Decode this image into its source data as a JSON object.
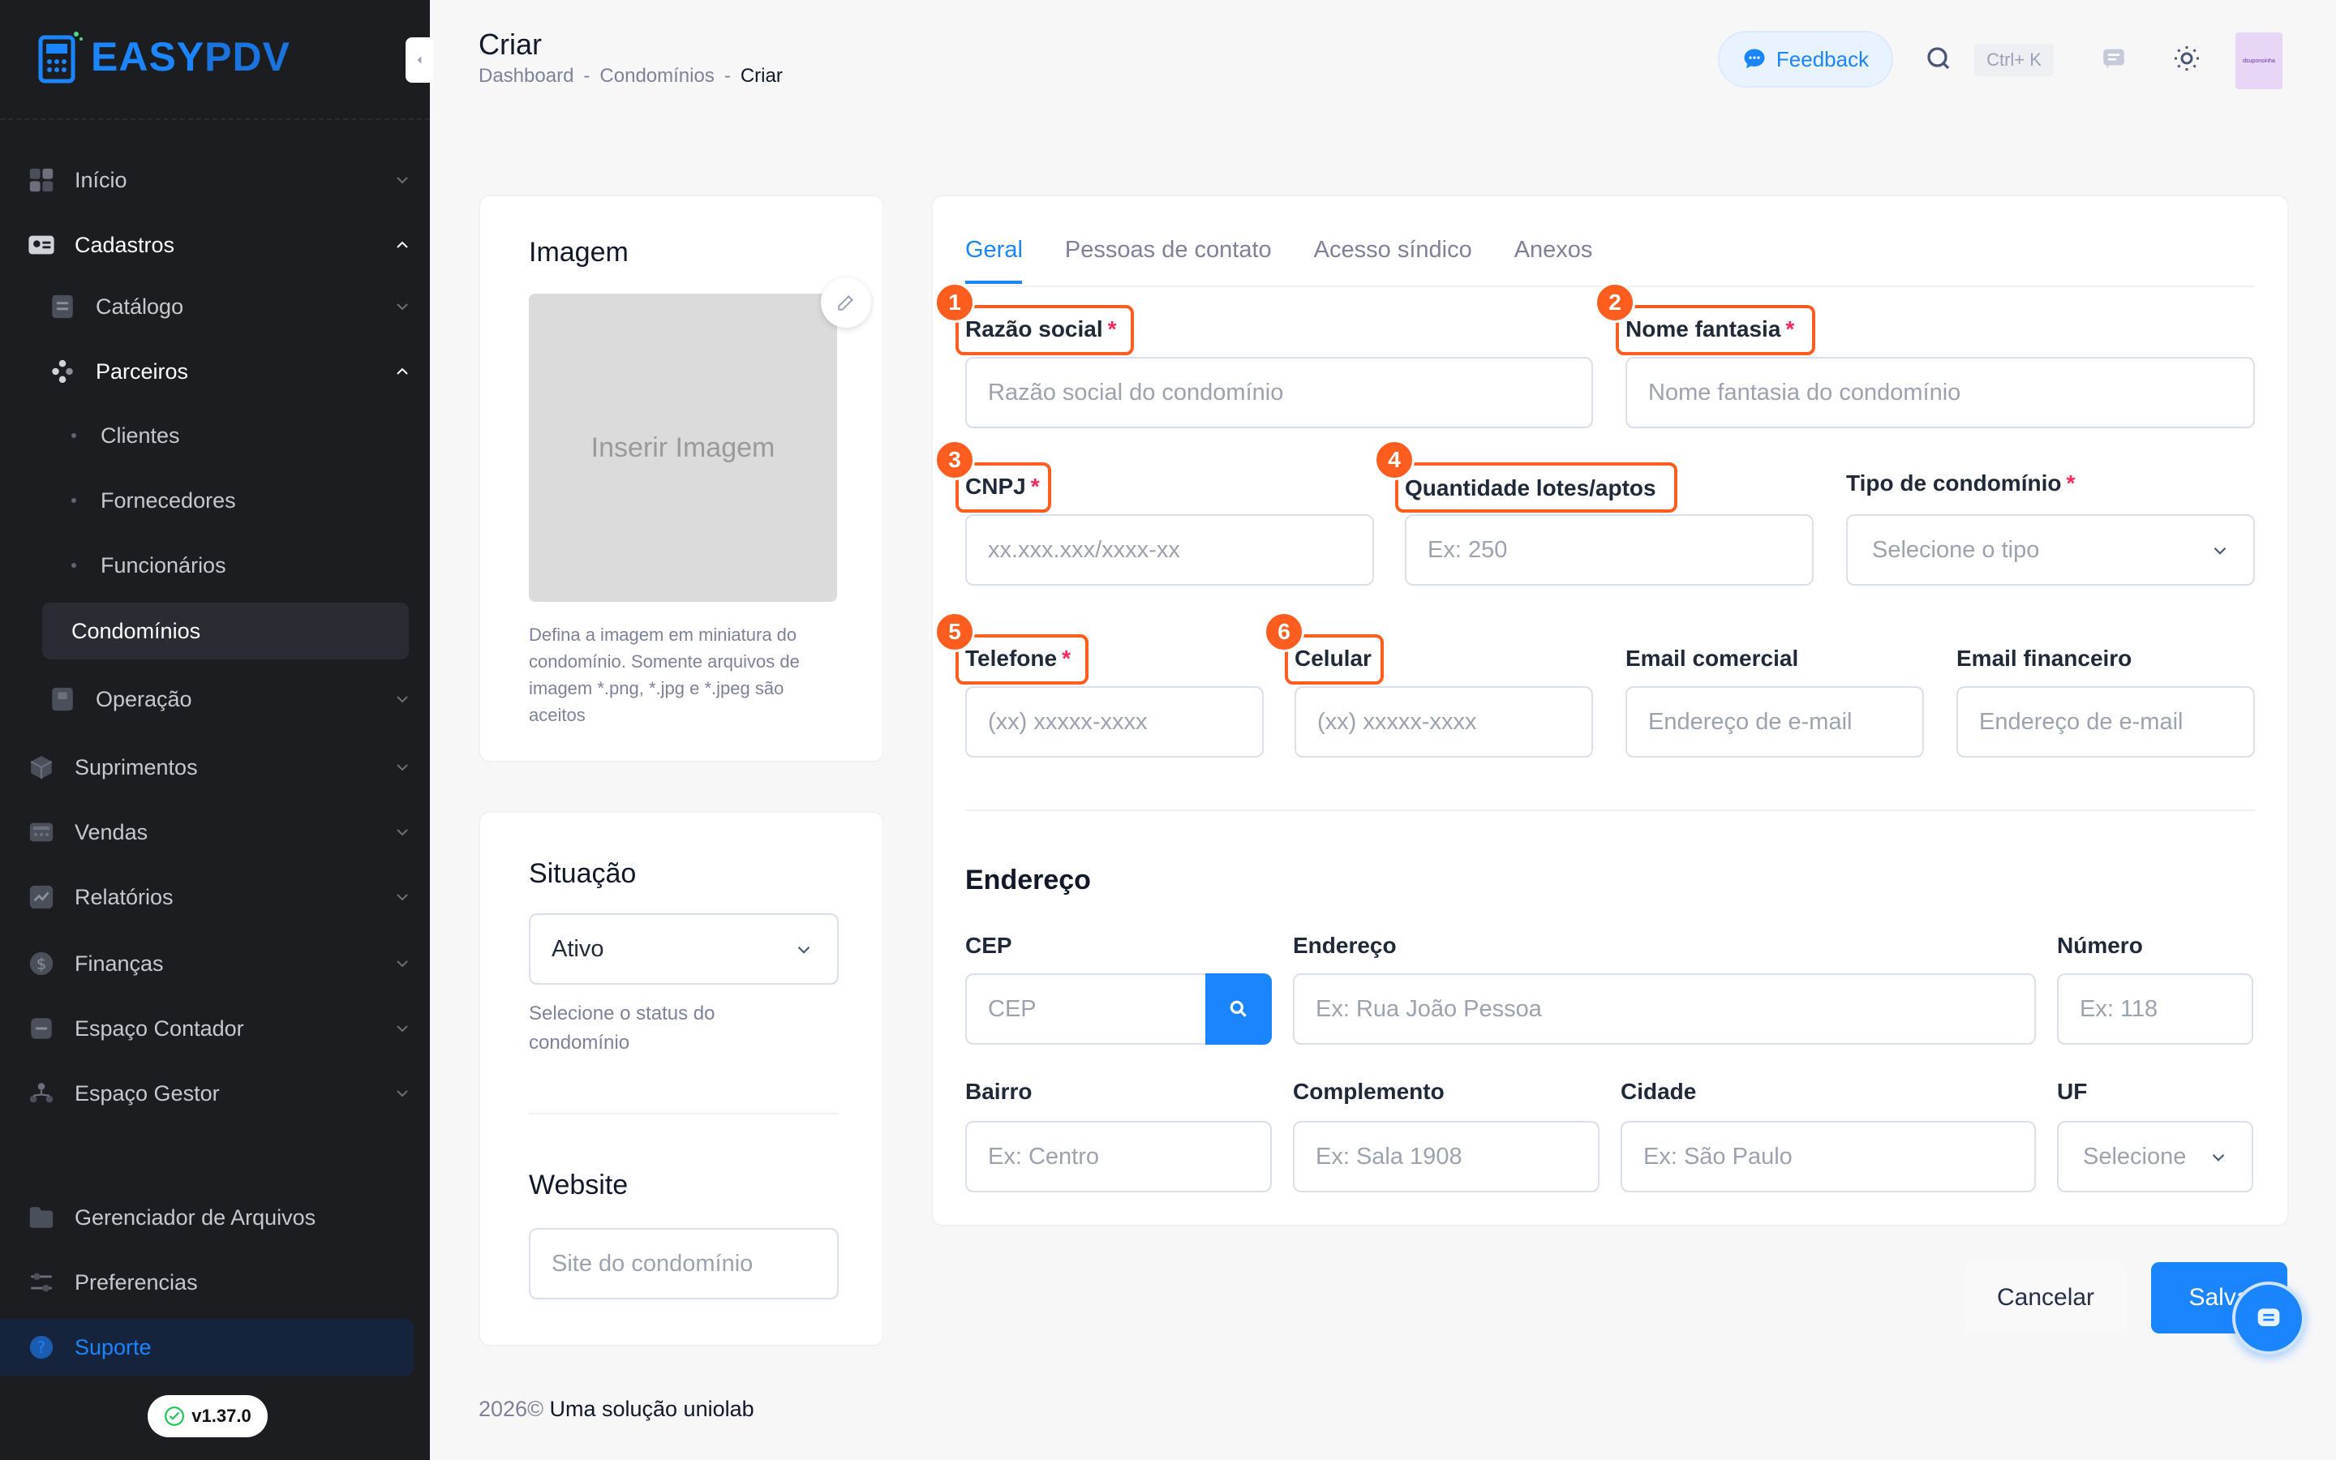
{
  "sidebar": {
    "logo_easy": "EASY",
    "logo_pdv": "PDV",
    "items": [
      {
        "label": "Início"
      },
      {
        "label": "Cadastros"
      },
      {
        "label": "Catálogo"
      },
      {
        "label": "Parceiros"
      },
      {
        "label": "Clientes"
      },
      {
        "label": "Fornecedores"
      },
      {
        "label": "Funcionários"
      },
      {
        "label": "Condomínios"
      },
      {
        "label": "Operação"
      },
      {
        "label": "Suprimentos"
      },
      {
        "label": "Vendas"
      },
      {
        "label": "Relatórios"
      },
      {
        "label": "Finanças"
      },
      {
        "label": "Espaço Contador"
      },
      {
        "label": "Espaço Gestor"
      },
      {
        "label": "Gerenciador de Arquivos"
      },
      {
        "label": "Preferencias"
      },
      {
        "label": "Suporte"
      }
    ],
    "version": "v1.37.0"
  },
  "header": {
    "title": "Criar",
    "breadcrumb": [
      "Dashboard",
      "-",
      "Condomínios",
      "-",
      "Criar"
    ],
    "feedback_label": "Feedback",
    "shortcut": "Ctrl+ K",
    "avatar_text": "dsuponsinha"
  },
  "image_card": {
    "title": "Imagem",
    "placeholder": "Inserir Imagem",
    "hint": "Defina a imagem em miniatura do condomínio. Somente arquivos de imagem *.png, *.jpg e *.jpeg são aceitos"
  },
  "status_card": {
    "title": "Situação",
    "selected": "Ativo",
    "hint": "Selecione o status do condomínio",
    "website_title": "Website",
    "website_placeholder": "Site do condomínio"
  },
  "tabs": [
    "Geral",
    "Pessoas de contato",
    "Acesso síndico",
    "Anexos"
  ],
  "form": {
    "razao_social": {
      "label": "Razão social",
      "placeholder": "Razão social do condomínio",
      "badge": "1"
    },
    "nome_fantasia": {
      "label": "Nome fantasia",
      "placeholder": "Nome fantasia do condomínio",
      "badge": "2"
    },
    "cnpj": {
      "label": "CNPJ",
      "placeholder": "xx.xxx.xxx/xxxx-xx",
      "badge": "3"
    },
    "quantidade": {
      "label": "Quantidade lotes/aptos",
      "placeholder": "Ex: 250",
      "badge": "4"
    },
    "tipo": {
      "label": "Tipo de condomínio",
      "placeholder": "Selecione o tipo"
    },
    "telefone": {
      "label": "Telefone",
      "placeholder": "(xx) xxxxx-xxxx",
      "badge": "5"
    },
    "celular": {
      "label": "Celular",
      "placeholder": "(xx) xxxxx-xxxx",
      "badge": "6"
    },
    "email_comercial": {
      "label": "Email comercial",
      "placeholder": "Endereço de e-mail"
    },
    "email_financeiro": {
      "label": "Email financeiro",
      "placeholder": "Endereço de e-mail"
    },
    "required_mark": "*"
  },
  "address": {
    "title": "Endereço",
    "cep": {
      "label": "CEP",
      "placeholder": "CEP"
    },
    "endereco": {
      "label": "Endereço",
      "placeholder": "Ex: Rua João Pessoa"
    },
    "numero": {
      "label": "Número",
      "placeholder": "Ex: 118"
    },
    "bairro": {
      "label": "Bairro",
      "placeholder": "Ex: Centro"
    },
    "complemento": {
      "label": "Complemento",
      "placeholder": "Ex: Sala 1908"
    },
    "cidade": {
      "label": "Cidade",
      "placeholder": "Ex: São Paulo"
    },
    "uf": {
      "label": "UF",
      "placeholder": "Selecione"
    }
  },
  "actions": {
    "cancel": "Cancelar",
    "save": "Salva"
  },
  "footer": {
    "year": "2026©",
    "brand": "Uma solução uniolab"
  },
  "colors": {
    "accent": "#1b84ff",
    "highlight": "#fe5d1f",
    "sidebar_bg": "#1c1d21",
    "required": "#f8285a"
  }
}
